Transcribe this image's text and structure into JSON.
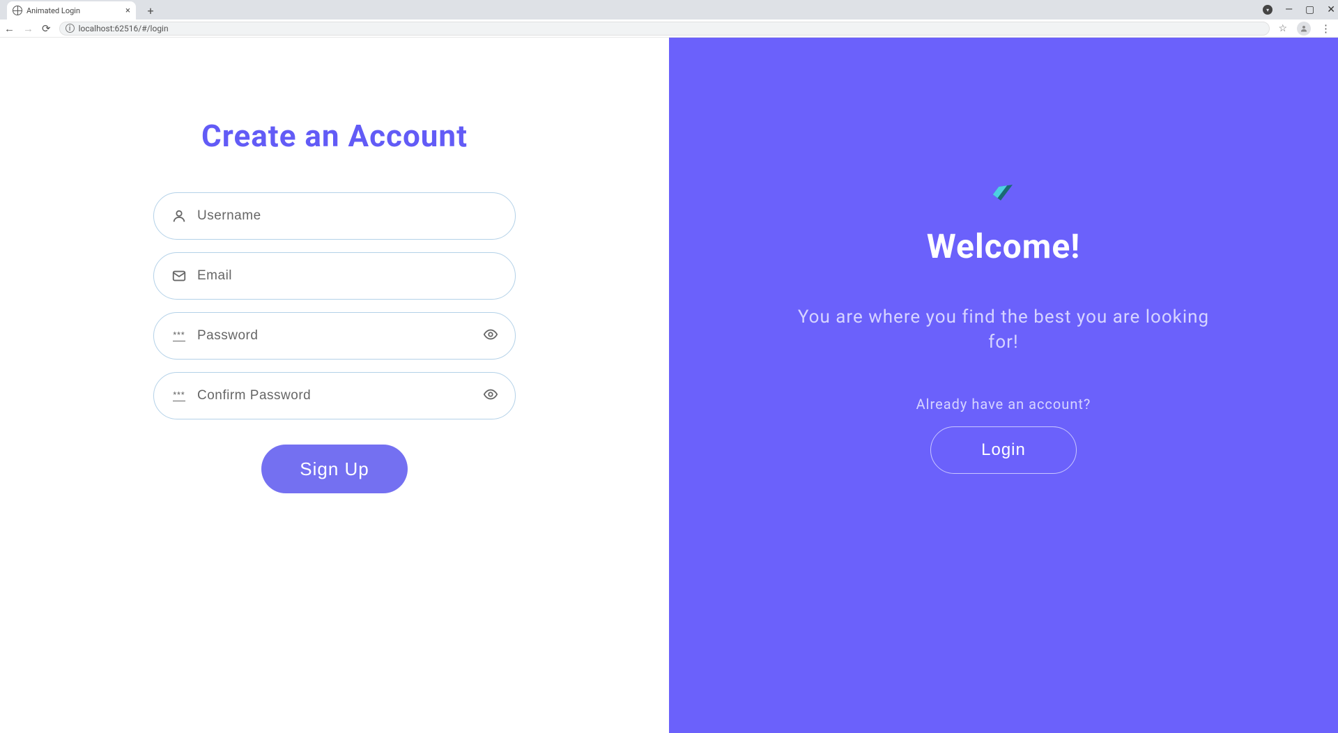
{
  "browser": {
    "tab_title": "Animated Login",
    "url": "localhost:62516/#/login"
  },
  "left": {
    "title": "Create an Account",
    "username_placeholder": "Username",
    "email_placeholder": "Email",
    "password_placeholder": "Password",
    "confirm_placeholder": "Confirm Password",
    "signup_button": "Sign Up"
  },
  "right": {
    "welcome_title": "Welcome!",
    "welcome_sub": "You are where you find the best you are looking for!",
    "already_text": "Already have an account?",
    "login_button": "Login"
  }
}
